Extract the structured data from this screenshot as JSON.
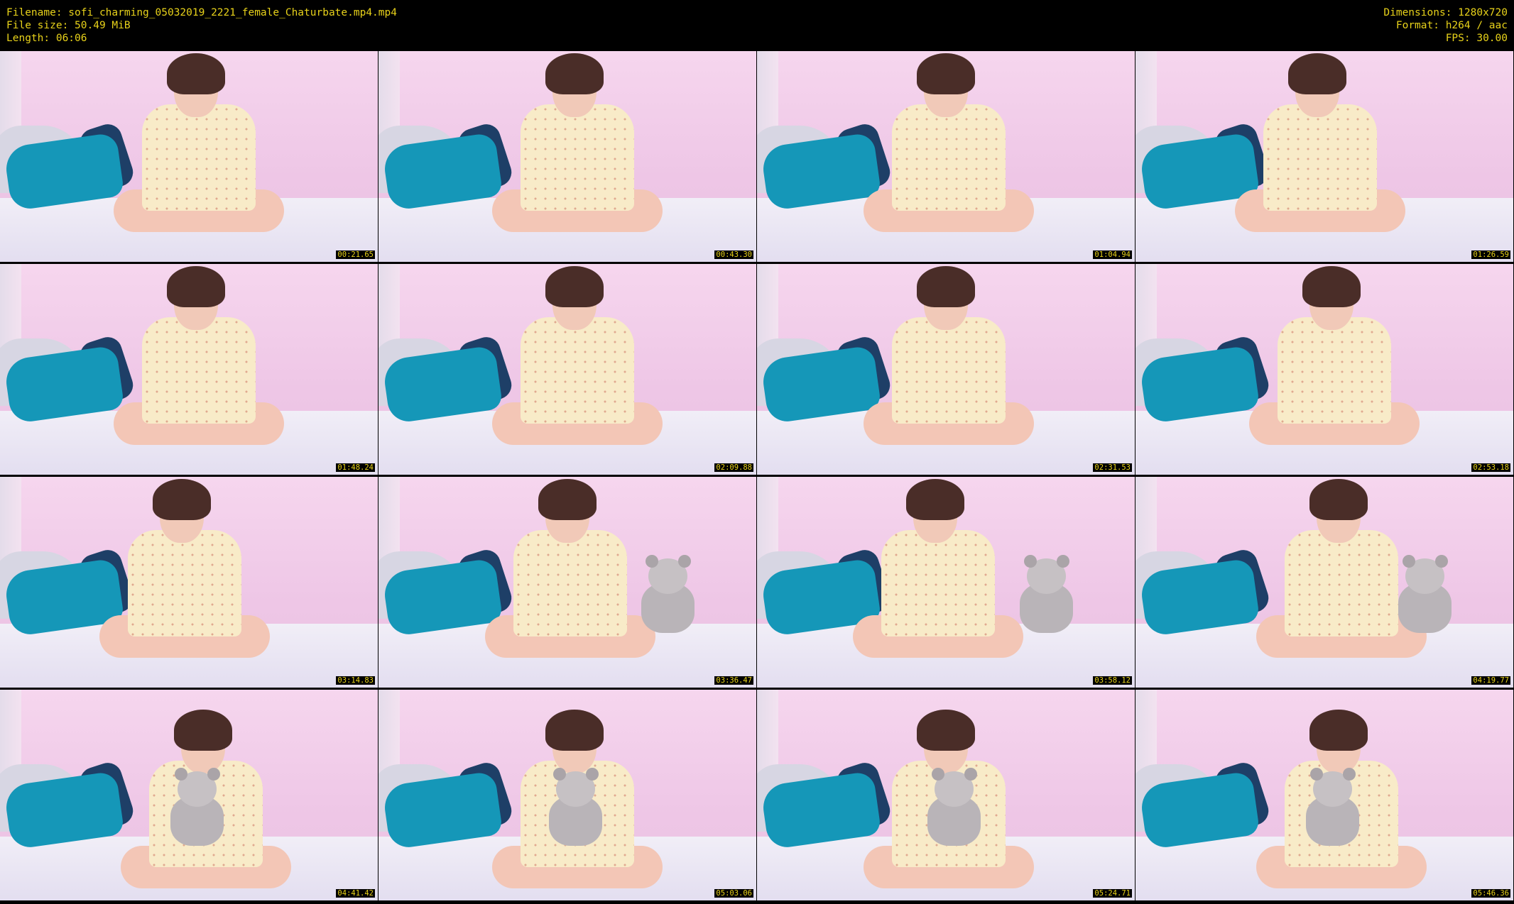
{
  "header": {
    "left": [
      "Filename: sofi_charming_05032019_2221_female_Chaturbate.mp4.mp4",
      "File size: 50.49 MiB",
      "Length: 06:06"
    ],
    "right": [
      "Dimensions: 1280x720",
      "Format: h264 / aac",
      "FPS: 30.00"
    ]
  },
  "colors": {
    "text": "#e8d21a",
    "background": "#000000"
  },
  "thumbnails": [
    {
      "time": "00:21.65"
    },
    {
      "time": "00:43.30"
    },
    {
      "time": "01:04.94"
    },
    {
      "time": "01:26.59"
    },
    {
      "time": "01:48.24"
    },
    {
      "time": "02:09.88"
    },
    {
      "time": "02:31.53"
    },
    {
      "time": "02:53.18"
    },
    {
      "time": "03:14.83"
    },
    {
      "time": "03:36.47"
    },
    {
      "time": "03:58.12"
    },
    {
      "time": "04:19.77"
    },
    {
      "time": "04:41.42"
    },
    {
      "time": "05:03.06"
    },
    {
      "time": "05:24.71"
    },
    {
      "time": "05:46.36"
    }
  ]
}
